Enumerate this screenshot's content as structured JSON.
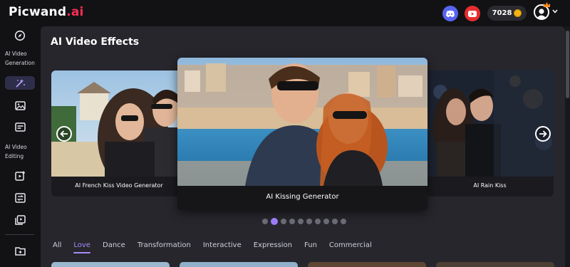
{
  "brand": {
    "name": "Picwand",
    "suffix": ".ai"
  },
  "header": {
    "credits": "7028",
    "icons": [
      "discord-icon",
      "youtube-icon",
      "coin-icon",
      "user-avatar-icon",
      "crown-icon",
      "chevron-down-icon"
    ]
  },
  "sidebar": {
    "section_generation": "AI Video Generation",
    "section_editing": "AI Video Editing",
    "icons": [
      "compass-icon",
      "magic-wand-icon",
      "image-icon",
      "caption-icon",
      "edit-video-icon",
      "swap-video-icon",
      "copy-video-icon",
      "folder-icon"
    ]
  },
  "main": {
    "title": "AI Video Effects",
    "carousel": {
      "cards": [
        {
          "label": "AI French Kiss Video Generator"
        },
        {
          "label": "AI Kissing Generator"
        },
        {
          "label": "AI Rain Kiss"
        }
      ],
      "active_index": 1,
      "total_slides": 10
    },
    "tabs": [
      "All",
      "Love",
      "Dance",
      "Transformation",
      "Interactive",
      "Expression",
      "Fun",
      "Commercial"
    ],
    "active_tab": "Love"
  },
  "colors": {
    "accent": "#9b7cf6",
    "brand_red": "#ff2d55",
    "background": "#121215",
    "panel": "#26262c"
  }
}
